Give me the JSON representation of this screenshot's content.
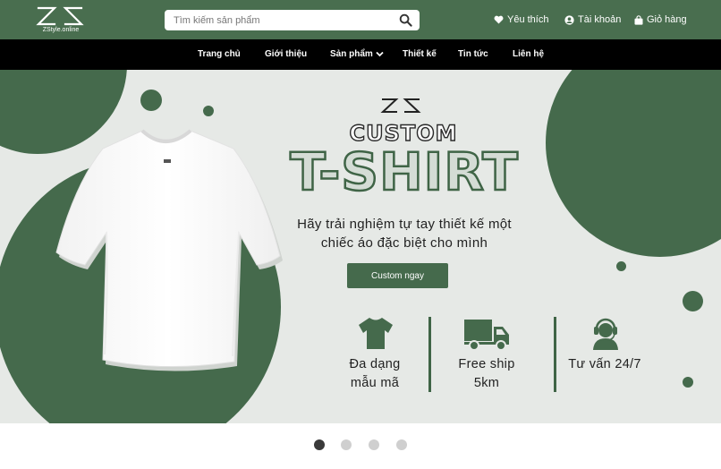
{
  "header": {
    "logo_subtext": "ZStyle.online",
    "search_placeholder": "Tìm kiếm sản phẩm",
    "links": {
      "wishlist": "Yêu thích",
      "account": "Tài khoản",
      "cart": "Giỏ hàng"
    }
  },
  "nav": {
    "items": [
      "Trang chủ",
      "Giới thiệu",
      "Sản phẩm",
      "Thiết kế",
      "Tin tức",
      "Liên hệ"
    ]
  },
  "hero": {
    "title_small": "CUSTOM",
    "title_big": "T-SHIRT",
    "tagline_line1": "Hãy trải nghiệm tự tay thiết kế một",
    "tagline_line2": "chiếc áo đặc biệt cho mình",
    "cta_label": "Custom ngay",
    "features": [
      {
        "icon": "tshirt-icon",
        "line1": "Đa dạng",
        "line2": "mẫu mã"
      },
      {
        "icon": "truck-icon",
        "line1": "Free ship",
        "line2": "5km"
      },
      {
        "icon": "support-agent-icon",
        "line1": "Tư vấn 24/7",
        "line2": ""
      }
    ]
  },
  "slider": {
    "dot_count": 4,
    "active_index": 0
  },
  "colors": {
    "brand_green": "#496e4f",
    "dark_green": "#456a4c",
    "nav_black": "#000000",
    "hero_bg": "#e6e9e6"
  }
}
